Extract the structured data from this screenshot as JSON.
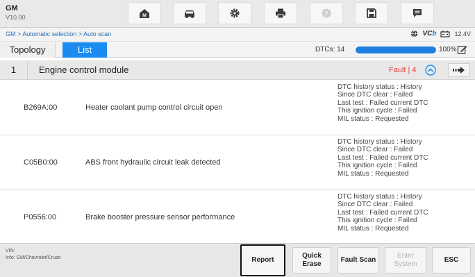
{
  "app": {
    "name": "GM",
    "version": "V10.00"
  },
  "toolbar": {
    "buttons": [
      {
        "name": "home-icon"
      },
      {
        "name": "vehicle-swap-icon"
      },
      {
        "name": "gear-icon"
      },
      {
        "name": "printer-icon"
      },
      {
        "name": "help-icon",
        "disabled": true
      },
      {
        "name": "save-icon"
      },
      {
        "name": "message-icon"
      }
    ]
  },
  "breadcrumb": "GM > Automatic selection > Auto scan",
  "status_bar": {
    "vci_label": "VC",
    "vci_label_accent": "b",
    "voltage": "12.4V"
  },
  "tabs": {
    "topology": "Topology",
    "list": "List"
  },
  "dtc_summary": {
    "label": "DTCs: 14",
    "progress": 1.0,
    "percent": "100%"
  },
  "module": {
    "index": "1",
    "name": "Engine control module",
    "fault": "Fault | 4"
  },
  "dtcs": [
    {
      "code": "B269A:00",
      "description": "Heater coolant pump control circuit open",
      "status": [
        "DTC history status : History",
        "Since DTC clear : Failed",
        "Last test : Failed current DTC",
        "This ignition cycle : Failed",
        "MIL status : Requested"
      ]
    },
    {
      "code": "C05B0:00",
      "description": "ABS front hydraulic circuit leak detected",
      "status": [
        "DTC history status : History",
        "Since DTC clear : Failed",
        "Last test : Failed current DTC",
        "This ignition cycle : Failed",
        "MIL status : Requested"
      ]
    },
    {
      "code": "P0556:00",
      "description": "Brake booster pressure sensor performance",
      "status": [
        "DTC history status : History",
        "Since DTC clear : Failed",
        "Last test : Failed current DTC",
        "This ignition cycle : Failed",
        "MIL status : Requested"
      ]
    }
  ],
  "footer": {
    "vin_label": "VIN:",
    "info": "Info: GM/Chevrolet/Cruze",
    "buttons": {
      "report": "Report",
      "quick_erase_1": "Quick",
      "quick_erase_2": "Erase",
      "fault_scan": "Fault Scan",
      "enter_system_1": "Enter",
      "enter_system_2": "System",
      "esc": "ESC"
    }
  },
  "colors": {
    "accent": "#1a8bf0",
    "fault": "#e53935",
    "link": "#2d6fb8"
  }
}
